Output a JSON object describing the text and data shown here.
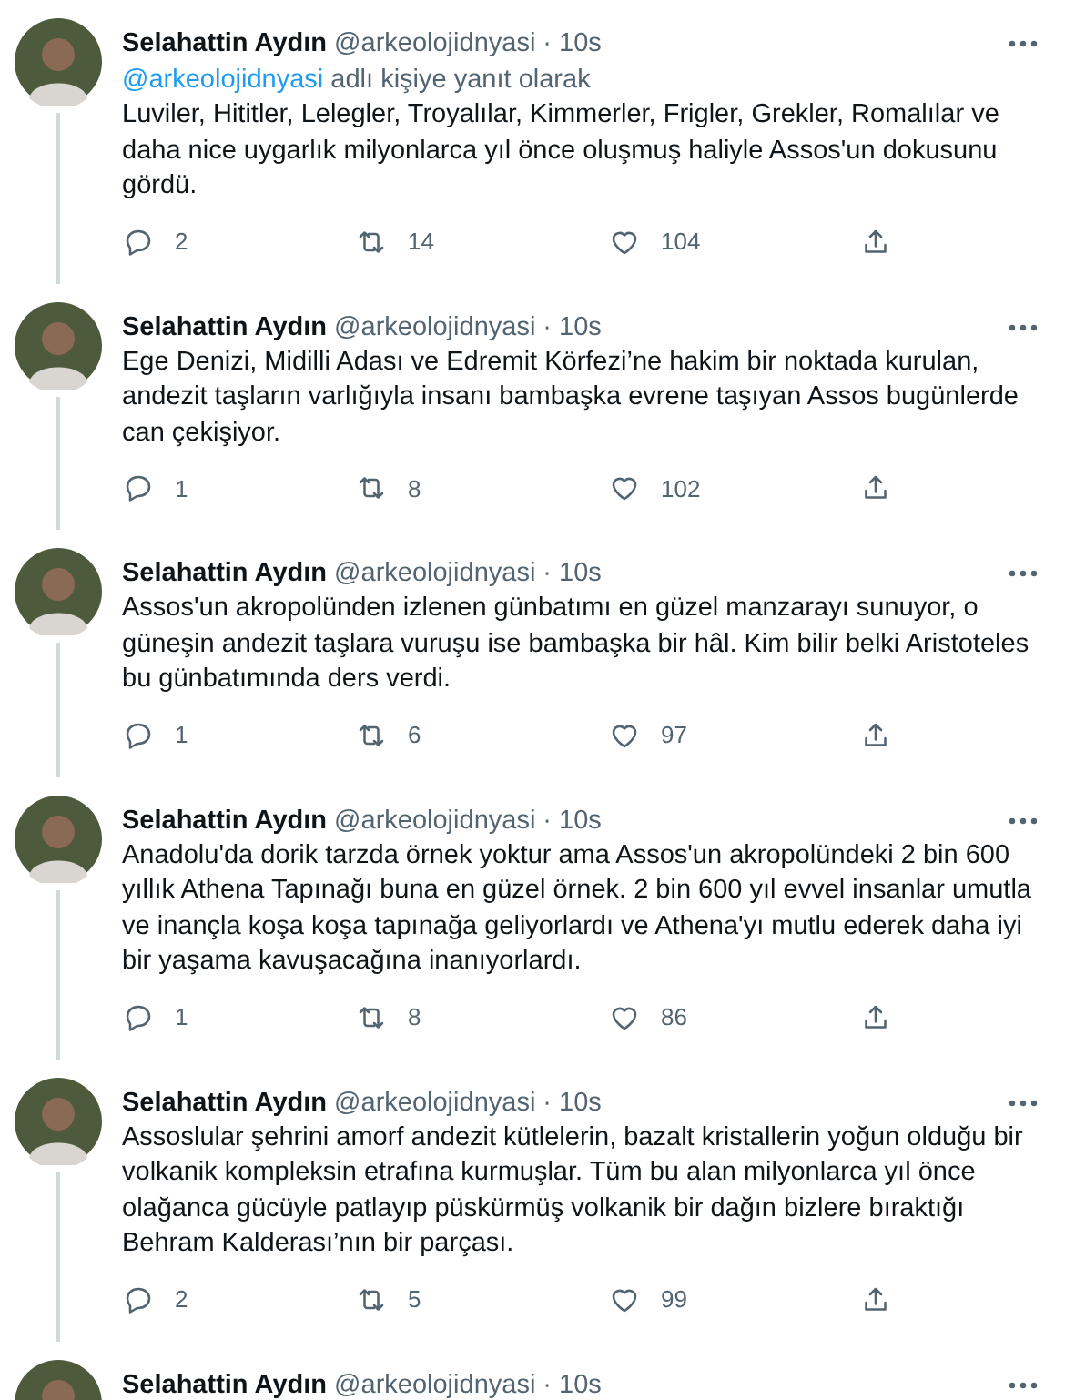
{
  "tweets": [
    {
      "name": "Selahattin Aydın",
      "handle": "@arkeolojidnyasi",
      "separator": "·",
      "time": "10s",
      "reply_to": {
        "handle": "@arkeolojidnyasi",
        "text": "adlı kişiye yanıt olarak"
      },
      "text": "Luviler, Hititler, Lelegler, Troyalılar, Kimmerler, Frigler, Grekler, Romalılar ve daha nice uygarlık milyonlarca yıl önce oluşmuş haliyle Assos'un dokusunu gördü.",
      "replies": "2",
      "retweets": "14",
      "likes": "104"
    },
    {
      "name": "Selahattin Aydın",
      "handle": "@arkeolojidnyasi",
      "separator": "·",
      "time": "10s",
      "text": "Ege Denizi, Midilli Adası ve Edremit Körfezi’ne hakim bir noktada kurulan, andezit taşların varlığıyla insanı bambaşka evrene taşıyan Assos bugünlerde can çekişiyor.",
      "replies": "1",
      "retweets": "8",
      "likes": "102"
    },
    {
      "name": "Selahattin Aydın",
      "handle": "@arkeolojidnyasi",
      "separator": "·",
      "time": "10s",
      "text": "Assos'un akropolünden izlenen günbatımı en güzel manzarayı sunuyor, o güneşin andezit taşlara vuruşu ise bambaşka bir hâl. Kim bilir belki Aristoteles bu günbatımında ders verdi.",
      "replies": "1",
      "retweets": "6",
      "likes": "97"
    },
    {
      "name": "Selahattin Aydın",
      "handle": "@arkeolojidnyasi",
      "separator": "·",
      "time": "10s",
      "text": "Anadolu'da dorik tarzda örnek yoktur ama Assos'un akropolündeki 2 bin 600 yıllık Athena Tapınağı buna en güzel örnek. 2 bin 600 yıl evvel insanlar umutla ve inançla koşa koşa tapınağa geliyorlardı ve Athena'yı mutlu ederek daha iyi bir yaşama kavuşacağına inanıyorlardı.",
      "replies": "1",
      "retweets": "8",
      "likes": "86"
    },
    {
      "name": "Selahattin Aydın",
      "handle": "@arkeolojidnyasi",
      "separator": "·",
      "time": "10s",
      "text": "Assoslular şehrini amorf andezit kütlelerin, bazalt kristallerin yoğun olduğu bir volkanik kompleksin etrafına kurmuşlar. Tüm bu alan milyonlarca yıl önce olağanca gücüyle patlayıp püskürmüş volkanik bir dağın bizlere bıraktığı Behram Kalderası’nın bir parçası.",
      "replies": "2",
      "retweets": "5",
      "likes": "99"
    },
    {
      "name": "Selahattin Aydın",
      "handle": "@arkeolojidnyasi",
      "separator": "·",
      "time": "10s"
    }
  ]
}
